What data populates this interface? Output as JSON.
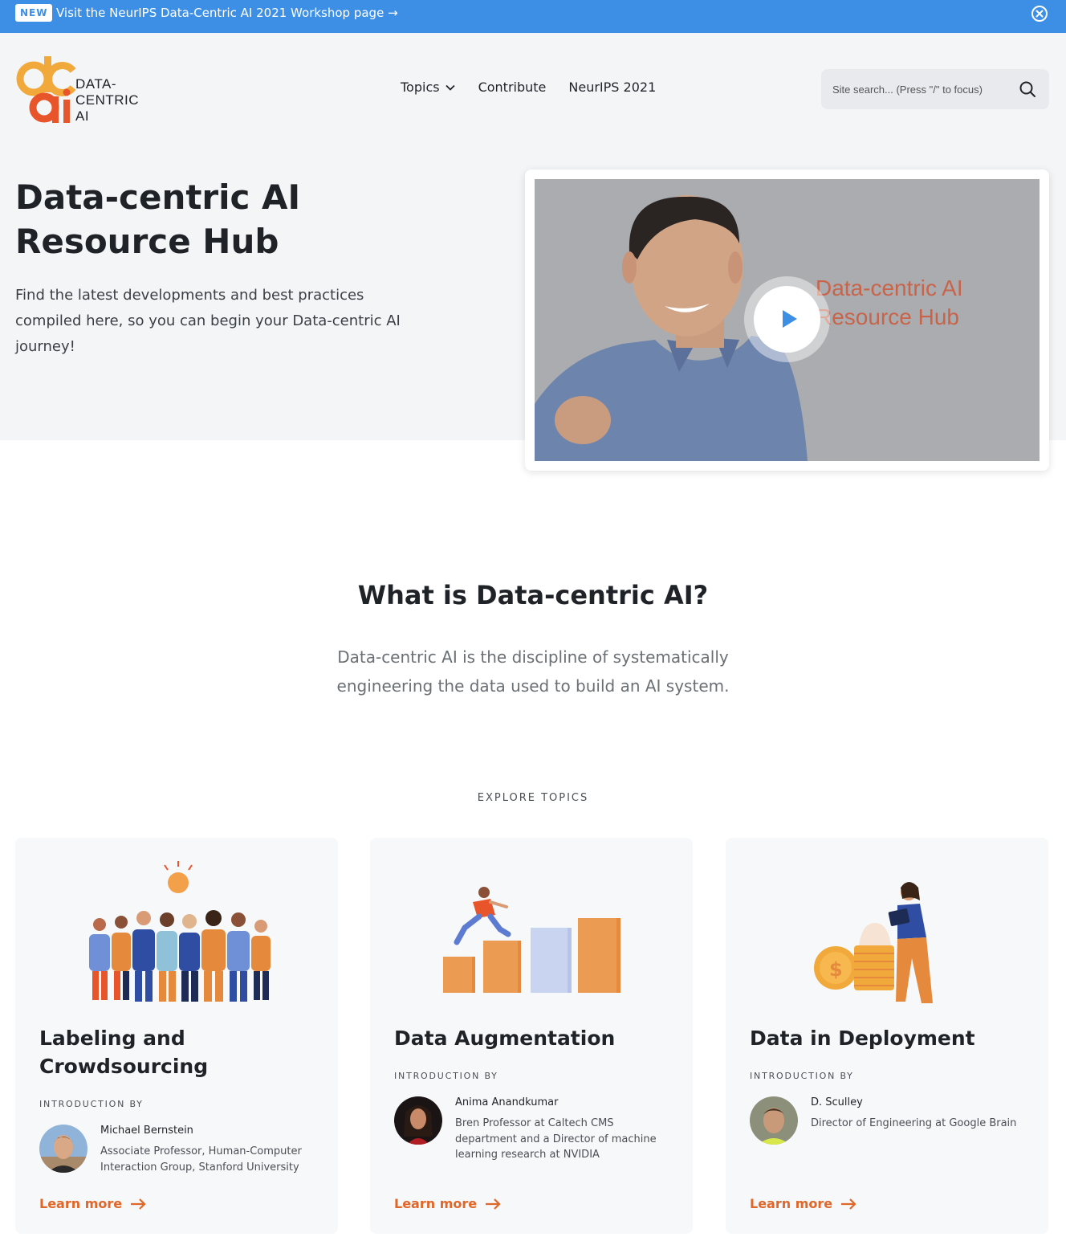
{
  "banner": {
    "badge": "NEW",
    "link_text": "Visit the NeurIPS Data-Centric AI 2021 Workshop page →"
  },
  "logo": {
    "line1": "DATA-",
    "line2": "CENTRIC",
    "line3": "AI"
  },
  "nav": {
    "topics": "Topics",
    "contribute": "Contribute",
    "neurips": "NeurIPS 2021"
  },
  "search": {
    "placeholder": "Site search... (Press \"/\" to focus)"
  },
  "hero": {
    "title": "Data-centric AI Resource Hub",
    "description": "Find the latest developments and best practices compiled here, so you can begin your Data-centric AI journey!",
    "video_text_line1": "Data-centric AI",
    "video_text_line2": "Resource Hub"
  },
  "what": {
    "title": "What is Data-centric AI?",
    "description": "Data-centric AI is the discipline of systematically engineering the data used to build an AI system."
  },
  "explore_label": "EXPLORE TOPICS",
  "cards": [
    {
      "title": "Labeling and Crowdsourcing",
      "intro_label": "INTRODUCTION BY",
      "name": "Michael Bernstein",
      "role": "Associate Professor, Human-Computer Interaction Group, Stanford University",
      "cta": "Learn more"
    },
    {
      "title": "Data Augmentation",
      "intro_label": "INTRODUCTION BY",
      "name": "Anima Anandkumar",
      "role": "Bren Professor at Caltech CMS department and a Director of machine learning research at NVIDIA",
      "cta": "Learn more"
    },
    {
      "title": "Data in Deployment",
      "intro_label": "INTRODUCTION BY",
      "name": "D. Sculley",
      "role": "Director of Engineering at Google Brain",
      "cta": "Learn more"
    }
  ],
  "colors": {
    "banner": "#3d8fe6",
    "accent": "#e0672a",
    "hero_bg": "#f4f5f7"
  }
}
